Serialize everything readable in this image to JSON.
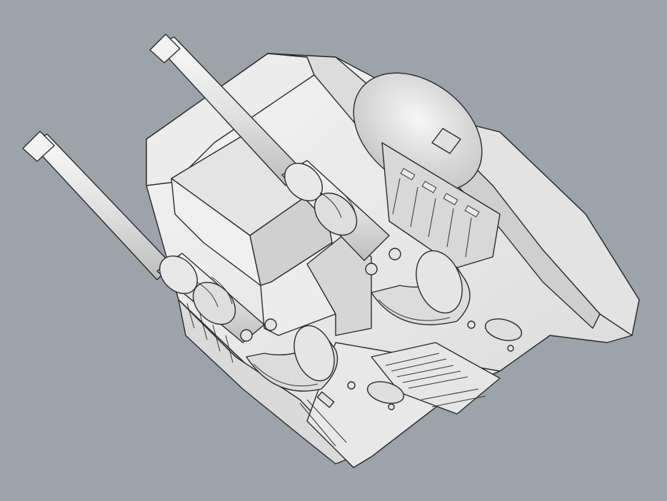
{
  "scene": {
    "background_color": "#9da3ab",
    "model_light": "#efefef",
    "model_mid": "#d6d6d6",
    "model_shade": "#b8b8b8",
    "outline_color": "#2a2a2a"
  }
}
